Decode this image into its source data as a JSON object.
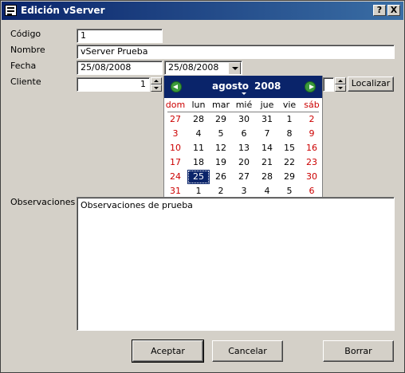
{
  "window": {
    "title": "Edición vServer",
    "help_btn": "?",
    "close_btn": "X"
  },
  "form": {
    "codigo": {
      "label": "Código",
      "value": "1"
    },
    "nombre": {
      "label": "Nombre",
      "value": "vServer Prueba"
    },
    "fecha": {
      "label": "Fecha",
      "value1": "25/08/2008",
      "value2": "25/08/2008"
    },
    "cliente": {
      "label": "Cliente",
      "value": "1",
      "localizar": "Localizar"
    },
    "observaciones": {
      "label": "Observaciones",
      "value": "Observaciones de prueba"
    }
  },
  "calendar": {
    "month": "agosto",
    "year": "2008",
    "weekdays": [
      "dom",
      "lun",
      "mar",
      "mié",
      "jue",
      "vie",
      "sáb"
    ],
    "weeks": [
      [
        "27",
        "28",
        "29",
        "30",
        "31",
        "1",
        "2"
      ],
      [
        "3",
        "4",
        "5",
        "6",
        "7",
        "8",
        "9"
      ],
      [
        "10",
        "11",
        "12",
        "13",
        "14",
        "15",
        "16"
      ],
      [
        "17",
        "18",
        "19",
        "20",
        "21",
        "22",
        "23"
      ],
      [
        "24",
        "25",
        "26",
        "27",
        "28",
        "29",
        "30"
      ],
      [
        "31",
        "1",
        "2",
        "3",
        "4",
        "5",
        "6"
      ]
    ],
    "selected": "25"
  },
  "buttons": {
    "aceptar": "Aceptar",
    "cancelar": "Cancelar",
    "borrar": "Borrar"
  }
}
